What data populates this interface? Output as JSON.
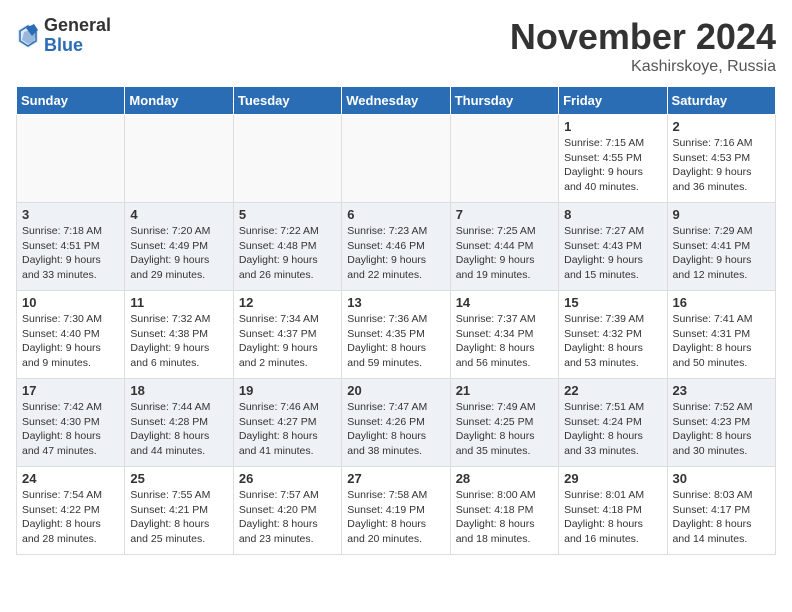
{
  "header": {
    "logo_general": "General",
    "logo_blue": "Blue",
    "month_title": "November 2024",
    "location": "Kashirskoye, Russia"
  },
  "weekdays": [
    "Sunday",
    "Monday",
    "Tuesday",
    "Wednesday",
    "Thursday",
    "Friday",
    "Saturday"
  ],
  "weeks": [
    [
      {
        "day": "",
        "info": ""
      },
      {
        "day": "",
        "info": ""
      },
      {
        "day": "",
        "info": ""
      },
      {
        "day": "",
        "info": ""
      },
      {
        "day": "",
        "info": ""
      },
      {
        "day": "1",
        "info": "Sunrise: 7:15 AM\nSunset: 4:55 PM\nDaylight: 9 hours\nand 40 minutes."
      },
      {
        "day": "2",
        "info": "Sunrise: 7:16 AM\nSunset: 4:53 PM\nDaylight: 9 hours\nand 36 minutes."
      }
    ],
    [
      {
        "day": "3",
        "info": "Sunrise: 7:18 AM\nSunset: 4:51 PM\nDaylight: 9 hours\nand 33 minutes."
      },
      {
        "day": "4",
        "info": "Sunrise: 7:20 AM\nSunset: 4:49 PM\nDaylight: 9 hours\nand 29 minutes."
      },
      {
        "day": "5",
        "info": "Sunrise: 7:22 AM\nSunset: 4:48 PM\nDaylight: 9 hours\nand 26 minutes."
      },
      {
        "day": "6",
        "info": "Sunrise: 7:23 AM\nSunset: 4:46 PM\nDaylight: 9 hours\nand 22 minutes."
      },
      {
        "day": "7",
        "info": "Sunrise: 7:25 AM\nSunset: 4:44 PM\nDaylight: 9 hours\nand 19 minutes."
      },
      {
        "day": "8",
        "info": "Sunrise: 7:27 AM\nSunset: 4:43 PM\nDaylight: 9 hours\nand 15 minutes."
      },
      {
        "day": "9",
        "info": "Sunrise: 7:29 AM\nSunset: 4:41 PM\nDaylight: 9 hours\nand 12 minutes."
      }
    ],
    [
      {
        "day": "10",
        "info": "Sunrise: 7:30 AM\nSunset: 4:40 PM\nDaylight: 9 hours\nand 9 minutes."
      },
      {
        "day": "11",
        "info": "Sunrise: 7:32 AM\nSunset: 4:38 PM\nDaylight: 9 hours\nand 6 minutes."
      },
      {
        "day": "12",
        "info": "Sunrise: 7:34 AM\nSunset: 4:37 PM\nDaylight: 9 hours\nand 2 minutes."
      },
      {
        "day": "13",
        "info": "Sunrise: 7:36 AM\nSunset: 4:35 PM\nDaylight: 8 hours\nand 59 minutes."
      },
      {
        "day": "14",
        "info": "Sunrise: 7:37 AM\nSunset: 4:34 PM\nDaylight: 8 hours\nand 56 minutes."
      },
      {
        "day": "15",
        "info": "Sunrise: 7:39 AM\nSunset: 4:32 PM\nDaylight: 8 hours\nand 53 minutes."
      },
      {
        "day": "16",
        "info": "Sunrise: 7:41 AM\nSunset: 4:31 PM\nDaylight: 8 hours\nand 50 minutes."
      }
    ],
    [
      {
        "day": "17",
        "info": "Sunrise: 7:42 AM\nSunset: 4:30 PM\nDaylight: 8 hours\nand 47 minutes."
      },
      {
        "day": "18",
        "info": "Sunrise: 7:44 AM\nSunset: 4:28 PM\nDaylight: 8 hours\nand 44 minutes."
      },
      {
        "day": "19",
        "info": "Sunrise: 7:46 AM\nSunset: 4:27 PM\nDaylight: 8 hours\nand 41 minutes."
      },
      {
        "day": "20",
        "info": "Sunrise: 7:47 AM\nSunset: 4:26 PM\nDaylight: 8 hours\nand 38 minutes."
      },
      {
        "day": "21",
        "info": "Sunrise: 7:49 AM\nSunset: 4:25 PM\nDaylight: 8 hours\nand 35 minutes."
      },
      {
        "day": "22",
        "info": "Sunrise: 7:51 AM\nSunset: 4:24 PM\nDaylight: 8 hours\nand 33 minutes."
      },
      {
        "day": "23",
        "info": "Sunrise: 7:52 AM\nSunset: 4:23 PM\nDaylight: 8 hours\nand 30 minutes."
      }
    ],
    [
      {
        "day": "24",
        "info": "Sunrise: 7:54 AM\nSunset: 4:22 PM\nDaylight: 8 hours\nand 28 minutes."
      },
      {
        "day": "25",
        "info": "Sunrise: 7:55 AM\nSunset: 4:21 PM\nDaylight: 8 hours\nand 25 minutes."
      },
      {
        "day": "26",
        "info": "Sunrise: 7:57 AM\nSunset: 4:20 PM\nDaylight: 8 hours\nand 23 minutes."
      },
      {
        "day": "27",
        "info": "Sunrise: 7:58 AM\nSunset: 4:19 PM\nDaylight: 8 hours\nand 20 minutes."
      },
      {
        "day": "28",
        "info": "Sunrise: 8:00 AM\nSunset: 4:18 PM\nDaylight: 8 hours\nand 18 minutes."
      },
      {
        "day": "29",
        "info": "Sunrise: 8:01 AM\nSunset: 4:18 PM\nDaylight: 8 hours\nand 16 minutes."
      },
      {
        "day": "30",
        "info": "Sunrise: 8:03 AM\nSunset: 4:17 PM\nDaylight: 8 hours\nand 14 minutes."
      }
    ]
  ]
}
